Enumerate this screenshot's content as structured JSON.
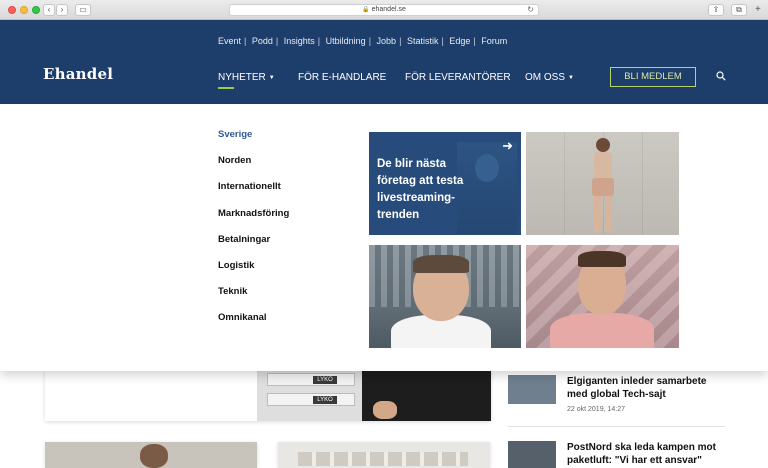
{
  "browser": {
    "url": "ehandel.se",
    "back_icon": "chevron-left",
    "forward_icon": "chevron-right"
  },
  "header": {
    "logo": "Ehandel",
    "top_links": [
      "Event",
      "Podd",
      "Insights",
      "Utbildning",
      "Jobb",
      "Statistik",
      "Edge",
      "Forum"
    ],
    "nav": [
      {
        "label": "NYHETER",
        "has_caret": true,
        "active": true
      },
      {
        "label": "FÖR E-HANDLARE",
        "has_caret": false
      },
      {
        "label": "FÖR LEVERANTÖRER",
        "has_caret": false
      },
      {
        "label": "OM OSS",
        "has_caret": true
      }
    ],
    "join_label": "BLI MEDLEM",
    "colors": {
      "background": "#1d3d6b",
      "accent": "#9cc94b"
    }
  },
  "dropdown": {
    "categories": [
      "Sverige",
      "Norden",
      "Internationellt",
      "Marknadsföring",
      "Betalningar",
      "Logistik",
      "Teknik",
      "Omnikanal"
    ],
    "active_category": "Sverige",
    "featured_title": "De blir nästa företag att testa livestreaming-trenden"
  },
  "page": {
    "box_label": "LYKO",
    "news": [
      {
        "title": "Elgiganten inleder samarbete med global Tech-sajt",
        "date": "22 okt 2019, 14:27"
      },
      {
        "title": "PostNord ska leda kampen mot paketluft: \"Vi har ett ansvar\"",
        "date": ""
      }
    ]
  }
}
